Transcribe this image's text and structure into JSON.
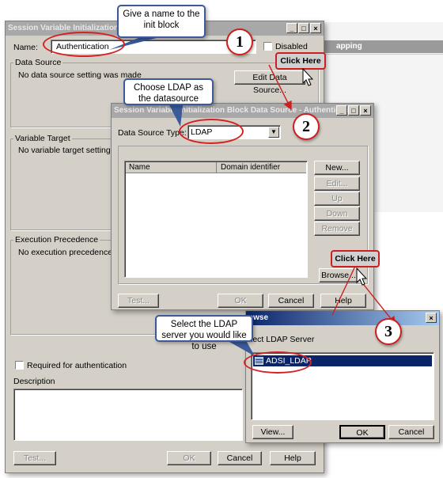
{
  "main_dialog": {
    "title": "Session Variable Initialization Blo",
    "name_label": "Name:",
    "name_value": "Authentication",
    "disabled_label": "Disabled",
    "data_source_label": "Data Source",
    "data_source_text": "No data source setting was made",
    "edit_data_source_button": "Edit Data Source...",
    "variable_target_label": "Variable Target",
    "variable_target_text": "No variable target setting was",
    "execution_precedence_label": "Execution Precedence",
    "execution_precedence_text": "No execution precedence setti",
    "required_auth_label": "Required for authentication",
    "description_label": "Description",
    "test_button": "Test...",
    "ok_button": "OK",
    "cancel_button": "Cancel",
    "help_button": "Help"
  },
  "background_window": {
    "header_text": "apping"
  },
  "ds_dialog": {
    "title": "Session Variable Initialization Block Data Source - Authentication",
    "type_label": "Data Source Type:",
    "type_value": "LDAP",
    "columns": [
      "Name",
      "Domain identifier"
    ],
    "new_button": "New...",
    "edit_button": "Edit...",
    "up_button": "Up",
    "down_button": "Down",
    "remove_button": "Remove",
    "browse_button": "Browse...",
    "test_button": "Test...",
    "ok_button": "OK",
    "cancel_button": "Cancel",
    "help_button": "Help"
  },
  "browse_dialog": {
    "title": "owse",
    "select_label": "lect LDAP Server",
    "selected_item": "ADSI_LDAP",
    "view_button": "View...",
    "ok_button": "OK",
    "cancel_button": "Cancel"
  },
  "annotations": {
    "callout1": "Give a name to the init block",
    "callout2": "Choose LDAP as the datasource",
    "callout3": "Select the LDAP server you would like to use",
    "click_here_1": "Click Here",
    "click_here_2": "Click Here",
    "step1": "1",
    "step2": "2",
    "step3": "3"
  },
  "colors": {
    "accent_red": "#cc1f1f",
    "callout_border": "#3a5a9a",
    "selection_blue": "#0a246a"
  },
  "icons": [
    "close-icon",
    "minimize-icon",
    "maximize-icon",
    "dropdown-arrow-icon",
    "cursor-icon",
    "ldap-server-icon"
  ]
}
